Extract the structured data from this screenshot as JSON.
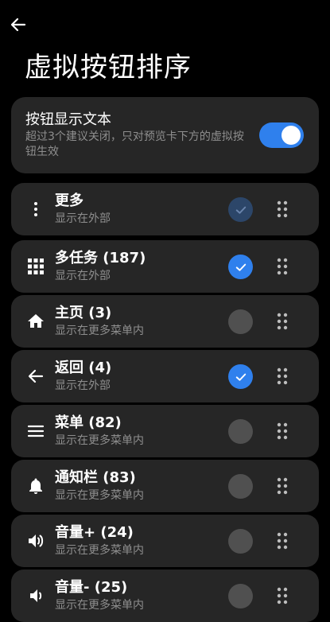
{
  "header": {
    "title": "虚拟按钮排序"
  },
  "setting": {
    "title": "按钮显示文本",
    "description": "超过3个建议关闭，只对预览卡下方的虚拟按钮生效",
    "enabled": true
  },
  "colors": {
    "accent": "#2f80ed",
    "card": "#262626",
    "background": "#000000",
    "secondary_text": "#8e8e8e"
  },
  "buttons": [
    {
      "label": "更多",
      "location": "显示在外部",
      "icon": "more-vertical-icon",
      "checked": true,
      "disabled": true
    },
    {
      "label": "多任务 (187)",
      "location": "显示在外部",
      "icon": "grid-apps-icon",
      "checked": true,
      "disabled": false
    },
    {
      "label": "主页 (3)",
      "location": "显示在更多菜单内",
      "icon": "home-icon",
      "checked": false,
      "disabled": false
    },
    {
      "label": "返回 (4)",
      "location": "显示在外部",
      "icon": "arrow-back-icon",
      "checked": true,
      "disabled": false
    },
    {
      "label": "菜单 (82)",
      "location": "显示在更多菜单内",
      "icon": "menu-icon",
      "checked": false,
      "disabled": false
    },
    {
      "label": "通知栏 (83)",
      "location": "显示在更多菜单内",
      "icon": "bell-icon",
      "checked": false,
      "disabled": false
    },
    {
      "label": "音量+ (24)",
      "location": "显示在更多菜单内",
      "icon": "volume-up-icon",
      "checked": false,
      "disabled": false
    },
    {
      "label": "音量- (25)",
      "location": "显示在更多菜单内",
      "icon": "volume-down-icon",
      "checked": false,
      "disabled": false
    }
  ]
}
